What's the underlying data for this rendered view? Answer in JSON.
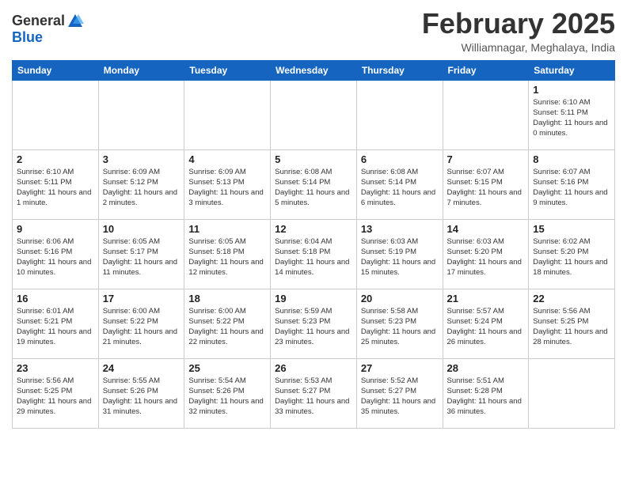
{
  "header": {
    "logo_general": "General",
    "logo_blue": "Blue",
    "month": "February 2025",
    "location": "Williamnagar, Meghalaya, India"
  },
  "days_of_week": [
    "Sunday",
    "Monday",
    "Tuesday",
    "Wednesday",
    "Thursday",
    "Friday",
    "Saturday"
  ],
  "weeks": [
    [
      {
        "day": "",
        "sunrise": "",
        "sunset": "",
        "daylight": ""
      },
      {
        "day": "",
        "sunrise": "",
        "sunset": "",
        "daylight": ""
      },
      {
        "day": "",
        "sunrise": "",
        "sunset": "",
        "daylight": ""
      },
      {
        "day": "",
        "sunrise": "",
        "sunset": "",
        "daylight": ""
      },
      {
        "day": "",
        "sunrise": "",
        "sunset": "",
        "daylight": ""
      },
      {
        "day": "",
        "sunrise": "",
        "sunset": "",
        "daylight": ""
      },
      {
        "day": "1",
        "sunrise": "Sunrise: 6:10 AM",
        "sunset": "Sunset: 5:11 PM",
        "daylight": "Daylight: 11 hours and 0 minutes."
      }
    ],
    [
      {
        "day": "2",
        "sunrise": "Sunrise: 6:10 AM",
        "sunset": "Sunset: 5:11 PM",
        "daylight": "Daylight: 11 hours and 1 minute."
      },
      {
        "day": "3",
        "sunrise": "Sunrise: 6:09 AM",
        "sunset": "Sunset: 5:12 PM",
        "daylight": "Daylight: 11 hours and 2 minutes."
      },
      {
        "day": "4",
        "sunrise": "Sunrise: 6:09 AM",
        "sunset": "Sunset: 5:13 PM",
        "daylight": "Daylight: 11 hours and 3 minutes."
      },
      {
        "day": "5",
        "sunrise": "Sunrise: 6:08 AM",
        "sunset": "Sunset: 5:14 PM",
        "daylight": "Daylight: 11 hours and 5 minutes."
      },
      {
        "day": "6",
        "sunrise": "Sunrise: 6:08 AM",
        "sunset": "Sunset: 5:14 PM",
        "daylight": "Daylight: 11 hours and 6 minutes."
      },
      {
        "day": "7",
        "sunrise": "Sunrise: 6:07 AM",
        "sunset": "Sunset: 5:15 PM",
        "daylight": "Daylight: 11 hours and 7 minutes."
      },
      {
        "day": "8",
        "sunrise": "Sunrise: 6:07 AM",
        "sunset": "Sunset: 5:16 PM",
        "daylight": "Daylight: 11 hours and 9 minutes."
      }
    ],
    [
      {
        "day": "9",
        "sunrise": "Sunrise: 6:06 AM",
        "sunset": "Sunset: 5:16 PM",
        "daylight": "Daylight: 11 hours and 10 minutes."
      },
      {
        "day": "10",
        "sunrise": "Sunrise: 6:05 AM",
        "sunset": "Sunset: 5:17 PM",
        "daylight": "Daylight: 11 hours and 11 minutes."
      },
      {
        "day": "11",
        "sunrise": "Sunrise: 6:05 AM",
        "sunset": "Sunset: 5:18 PM",
        "daylight": "Daylight: 11 hours and 12 minutes."
      },
      {
        "day": "12",
        "sunrise": "Sunrise: 6:04 AM",
        "sunset": "Sunset: 5:18 PM",
        "daylight": "Daylight: 11 hours and 14 minutes."
      },
      {
        "day": "13",
        "sunrise": "Sunrise: 6:03 AM",
        "sunset": "Sunset: 5:19 PM",
        "daylight": "Daylight: 11 hours and 15 minutes."
      },
      {
        "day": "14",
        "sunrise": "Sunrise: 6:03 AM",
        "sunset": "Sunset: 5:20 PM",
        "daylight": "Daylight: 11 hours and 17 minutes."
      },
      {
        "day": "15",
        "sunrise": "Sunrise: 6:02 AM",
        "sunset": "Sunset: 5:20 PM",
        "daylight": "Daylight: 11 hours and 18 minutes."
      }
    ],
    [
      {
        "day": "16",
        "sunrise": "Sunrise: 6:01 AM",
        "sunset": "Sunset: 5:21 PM",
        "daylight": "Daylight: 11 hours and 19 minutes."
      },
      {
        "day": "17",
        "sunrise": "Sunrise: 6:00 AM",
        "sunset": "Sunset: 5:22 PM",
        "daylight": "Daylight: 11 hours and 21 minutes."
      },
      {
        "day": "18",
        "sunrise": "Sunrise: 6:00 AM",
        "sunset": "Sunset: 5:22 PM",
        "daylight": "Daylight: 11 hours and 22 minutes."
      },
      {
        "day": "19",
        "sunrise": "Sunrise: 5:59 AM",
        "sunset": "Sunset: 5:23 PM",
        "daylight": "Daylight: 11 hours and 23 minutes."
      },
      {
        "day": "20",
        "sunrise": "Sunrise: 5:58 AM",
        "sunset": "Sunset: 5:23 PM",
        "daylight": "Daylight: 11 hours and 25 minutes."
      },
      {
        "day": "21",
        "sunrise": "Sunrise: 5:57 AM",
        "sunset": "Sunset: 5:24 PM",
        "daylight": "Daylight: 11 hours and 26 minutes."
      },
      {
        "day": "22",
        "sunrise": "Sunrise: 5:56 AM",
        "sunset": "Sunset: 5:25 PM",
        "daylight": "Daylight: 11 hours and 28 minutes."
      }
    ],
    [
      {
        "day": "23",
        "sunrise": "Sunrise: 5:56 AM",
        "sunset": "Sunset: 5:25 PM",
        "daylight": "Daylight: 11 hours and 29 minutes."
      },
      {
        "day": "24",
        "sunrise": "Sunrise: 5:55 AM",
        "sunset": "Sunset: 5:26 PM",
        "daylight": "Daylight: 11 hours and 31 minutes."
      },
      {
        "day": "25",
        "sunrise": "Sunrise: 5:54 AM",
        "sunset": "Sunset: 5:26 PM",
        "daylight": "Daylight: 11 hours and 32 minutes."
      },
      {
        "day": "26",
        "sunrise": "Sunrise: 5:53 AM",
        "sunset": "Sunset: 5:27 PM",
        "daylight": "Daylight: 11 hours and 33 minutes."
      },
      {
        "day": "27",
        "sunrise": "Sunrise: 5:52 AM",
        "sunset": "Sunset: 5:27 PM",
        "daylight": "Daylight: 11 hours and 35 minutes."
      },
      {
        "day": "28",
        "sunrise": "Sunrise: 5:51 AM",
        "sunset": "Sunset: 5:28 PM",
        "daylight": "Daylight: 11 hours and 36 minutes."
      },
      {
        "day": "",
        "sunrise": "",
        "sunset": "",
        "daylight": ""
      }
    ]
  ]
}
